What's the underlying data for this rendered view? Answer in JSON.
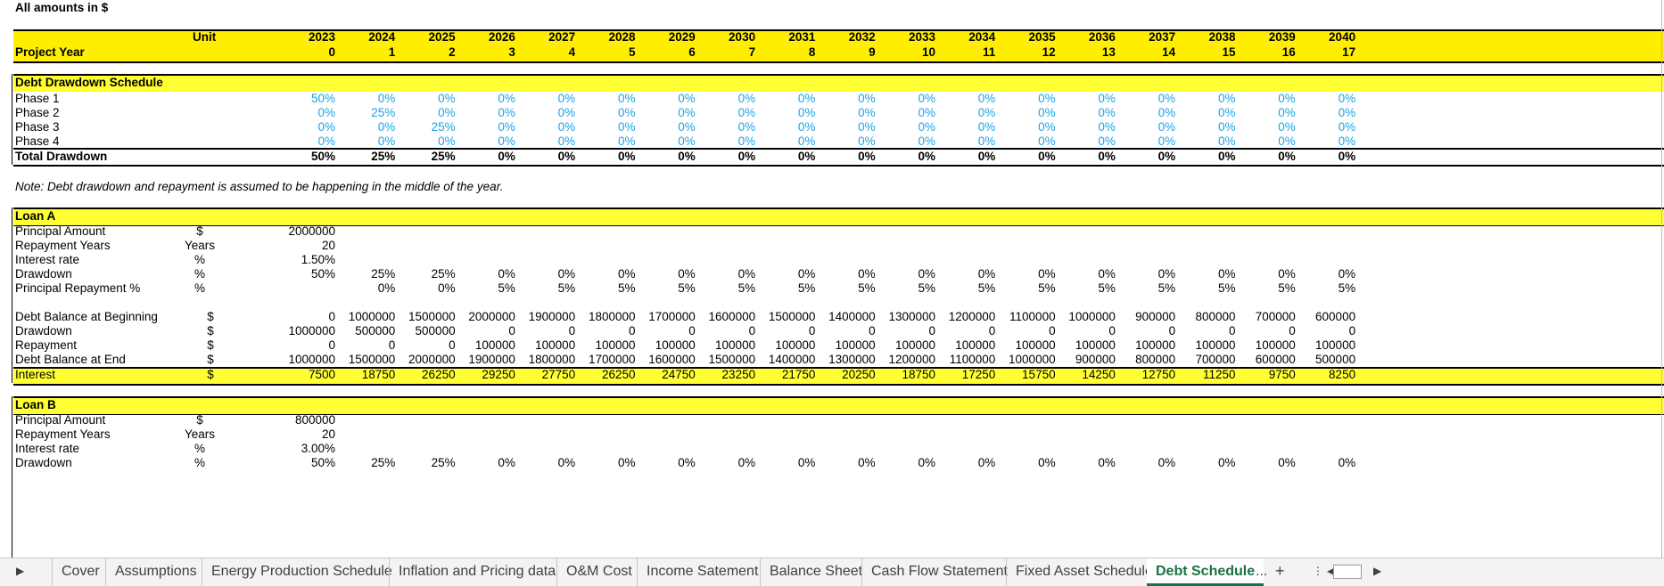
{
  "header_note": "All amounts in $",
  "unit_header": "Unit",
  "project_year_label": "Project Year",
  "years": [
    "2023",
    "2024",
    "2025",
    "2026",
    "2027",
    "2028",
    "2029",
    "2030",
    "2031",
    "2032",
    "2033",
    "2034",
    "2035",
    "2036",
    "2037",
    "2038",
    "2039",
    "2040"
  ],
  "project_years": [
    "0",
    "1",
    "2",
    "3",
    "4",
    "5",
    "6",
    "7",
    "8",
    "9",
    "10",
    "11",
    "12",
    "13",
    "14",
    "15",
    "16",
    "17"
  ],
  "drawdown_schedule": {
    "title": "Debt Drawdown Schedule",
    "rows": [
      {
        "label": "Phase 1",
        "values": [
          "50%",
          "0%",
          "0%",
          "0%",
          "0%",
          "0%",
          "0%",
          "0%",
          "0%",
          "0%",
          "0%",
          "0%",
          "0%",
          "0%",
          "0%",
          "0%",
          "0%",
          "0%"
        ]
      },
      {
        "label": "Phase 2",
        "values": [
          "0%",
          "25%",
          "0%",
          "0%",
          "0%",
          "0%",
          "0%",
          "0%",
          "0%",
          "0%",
          "0%",
          "0%",
          "0%",
          "0%",
          "0%",
          "0%",
          "0%",
          "0%"
        ]
      },
      {
        "label": "Phase 3",
        "values": [
          "0%",
          "0%",
          "25%",
          "0%",
          "0%",
          "0%",
          "0%",
          "0%",
          "0%",
          "0%",
          "0%",
          "0%",
          "0%",
          "0%",
          "0%",
          "0%",
          "0%",
          "0%"
        ]
      },
      {
        "label": "Phase 4",
        "values": [
          "0%",
          "0%",
          "0%",
          "0%",
          "0%",
          "0%",
          "0%",
          "0%",
          "0%",
          "0%",
          "0%",
          "0%",
          "0%",
          "0%",
          "0%",
          "0%",
          "0%",
          "0%"
        ]
      }
    ],
    "total": {
      "label": "Total Drawdown",
      "values": [
        "50%",
        "25%",
        "25%",
        "0%",
        "0%",
        "0%",
        "0%",
        "0%",
        "0%",
        "0%",
        "0%",
        "0%",
        "0%",
        "0%",
        "0%",
        "0%",
        "0%",
        "0%"
      ]
    }
  },
  "note": "Note: Debt drawdown and repayment is assumed to be happening in the middle of the year.",
  "loan_a": {
    "title": "Loan A",
    "params": [
      {
        "label": "Principal Amount",
        "unit": "$",
        "values": [
          "2000000"
        ]
      },
      {
        "label": "Repayment Years",
        "unit": "Years",
        "values": [
          "20"
        ]
      },
      {
        "label": "Interest rate",
        "unit": "%",
        "values": [
          "1.50%"
        ]
      },
      {
        "label": "Drawdown",
        "unit": "%",
        "values": [
          "50%",
          "25%",
          "25%",
          "0%",
          "0%",
          "0%",
          "0%",
          "0%",
          "0%",
          "0%",
          "0%",
          "0%",
          "0%",
          "0%",
          "0%",
          "0%",
          "0%",
          "0%"
        ]
      },
      {
        "label": "Principal Repayment %",
        "unit": "%",
        "values": [
          "",
          "0%",
          "0%",
          "5%",
          "5%",
          "5%",
          "5%",
          "5%",
          "5%",
          "5%",
          "5%",
          "5%",
          "5%",
          "5%",
          "5%",
          "5%",
          "5%",
          "5%"
        ]
      }
    ],
    "balances": [
      {
        "label": "Debt Balance at Beginning",
        "unit": "$",
        "values": [
          "0",
          "1000000",
          "1500000",
          "2000000",
          "1900000",
          "1800000",
          "1700000",
          "1600000",
          "1500000",
          "1400000",
          "1300000",
          "1200000",
          "1100000",
          "1000000",
          "900000",
          "800000",
          "700000",
          "600000"
        ]
      },
      {
        "label": "Drawdown",
        "unit": "$",
        "values": [
          "1000000",
          "500000",
          "500000",
          "0",
          "0",
          "0",
          "0",
          "0",
          "0",
          "0",
          "0",
          "0",
          "0",
          "0",
          "0",
          "0",
          "0",
          "0"
        ]
      },
      {
        "label": "Repayment",
        "unit": "$",
        "values": [
          "0",
          "0",
          "0",
          "100000",
          "100000",
          "100000",
          "100000",
          "100000",
          "100000",
          "100000",
          "100000",
          "100000",
          "100000",
          "100000",
          "100000",
          "100000",
          "100000",
          "100000"
        ]
      },
      {
        "label": "Debt Balance at End",
        "unit": "$",
        "values": [
          "1000000",
          "1500000",
          "2000000",
          "1900000",
          "1800000",
          "1700000",
          "1600000",
          "1500000",
          "1400000",
          "1300000",
          "1200000",
          "1100000",
          "1000000",
          "900000",
          "800000",
          "700000",
          "600000",
          "500000"
        ]
      }
    ],
    "interest": {
      "label": "Interest",
      "unit": "$",
      "values": [
        "7500",
        "18750",
        "26250",
        "29250",
        "27750",
        "26250",
        "24750",
        "23250",
        "21750",
        "20250",
        "18750",
        "17250",
        "15750",
        "14250",
        "12750",
        "11250",
        "9750",
        "8250"
      ]
    }
  },
  "loan_b": {
    "title": "Loan B",
    "params": [
      {
        "label": "Principal Amount",
        "unit": "$",
        "values": [
          "800000"
        ]
      },
      {
        "label": "Repayment Years",
        "unit": "Years",
        "values": [
          "20"
        ]
      },
      {
        "label": "Interest rate",
        "unit": "%",
        "values": [
          "3.00%"
        ]
      },
      {
        "label": "Drawdown",
        "unit": "%",
        "values": [
          "50%",
          "25%",
          "25%",
          "0%",
          "0%",
          "0%",
          "0%",
          "0%",
          "0%",
          "0%",
          "0%",
          "0%",
          "0%",
          "0%",
          "0%",
          "0%",
          "0%",
          "0%"
        ]
      }
    ]
  },
  "tabs": [
    "Cover",
    "Assumptions",
    "Energy Production Schedule",
    "Inflation and Pricing data",
    "O&M Cost",
    "Income Satement",
    "Balance Sheet",
    "Cash Flow Statement",
    "Fixed Asset Schedule",
    "Debt Schedule"
  ],
  "active_tab": "Debt Schedule",
  "tab_more": "...",
  "tab_add": "+",
  "colors": {
    "band_yellow": "#ffff33",
    "header_gold": "#ffee00",
    "input_blue": "#1aa3e8",
    "active_tab": "#1e7145"
  }
}
